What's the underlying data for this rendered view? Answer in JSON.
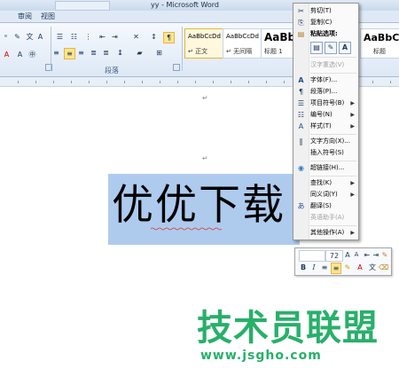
{
  "window": {
    "title": "yy - Microsoft Word"
  },
  "tabs": [
    "审阅",
    "视图"
  ],
  "ribbon": {
    "paragraph_group_label": "段落",
    "styles": [
      {
        "sample": "AaBbCcDd",
        "name": "↵ 正文",
        "selected": true
      },
      {
        "sample": "AaBbCcDd",
        "name": "↵ 无间隔",
        "selected": false
      },
      {
        "sample": "AaBb",
        "name": "标题 1",
        "selected": false
      }
    ],
    "style_right_sample": "AaBbC",
    "style_right_name": "标题"
  },
  "document": {
    "selected_text": "优优下载",
    "para_mark": "↵"
  },
  "context_menu": {
    "items": [
      {
        "label": "剪切(T)",
        "icon": "scissors-icon",
        "glyph": "✂",
        "enabled": true
      },
      {
        "label": "复制(C)",
        "icon": "copy-icon",
        "glyph": "⎘",
        "enabled": true
      },
      {
        "label": "粘贴选项:",
        "icon": "paste-icon",
        "glyph": "📋",
        "enabled": true,
        "header": true
      },
      {
        "label": "汉字重选(V)",
        "icon": "",
        "glyph": "",
        "enabled": false
      },
      {
        "label": "字体(F)...",
        "icon": "font-icon",
        "glyph": "A",
        "enabled": true
      },
      {
        "label": "段落(P)...",
        "icon": "paragraph-icon",
        "glyph": "¶",
        "enabled": true
      },
      {
        "label": "项目符号(B)",
        "icon": "bullets-icon",
        "glyph": "☰",
        "enabled": true,
        "submenu": true
      },
      {
        "label": "编号(N)",
        "icon": "numbering-icon",
        "glyph": "☷",
        "enabled": true,
        "submenu": true
      },
      {
        "label": "样式(T)",
        "icon": "styles-icon",
        "glyph": "A",
        "enabled": true,
        "submenu": true
      },
      {
        "label": "文字方向(X)...",
        "icon": "text-direction-icon",
        "glyph": "‖",
        "enabled": true
      },
      {
        "label": "插入符号(S)",
        "icon": "",
        "glyph": "",
        "enabled": true
      },
      {
        "label": "超链接(H)...",
        "icon": "hyperlink-icon",
        "glyph": "🌐",
        "enabled": true
      },
      {
        "label": "查找(K)",
        "icon": "",
        "glyph": "",
        "enabled": true,
        "submenu": true
      },
      {
        "label": "同义词(Y)",
        "icon": "",
        "glyph": "",
        "enabled": true,
        "submenu": true
      },
      {
        "label": "翻译(S)",
        "icon": "translate-icon",
        "glyph": "あ",
        "enabled": true
      },
      {
        "label": "英语助手(A)",
        "icon": "",
        "glyph": "",
        "enabled": false
      },
      {
        "label": "其他操作(A)",
        "icon": "",
        "glyph": "",
        "enabled": true,
        "submenu": true
      }
    ],
    "paste_options": [
      "keep-format-icon",
      "merge-format-icon",
      "text-only-icon"
    ]
  },
  "mini_toolbar": {
    "font_size": "72",
    "bold": "B",
    "italic": "I"
  },
  "watermark": {
    "line1": "技术员联盟",
    "line2": "www.jsgho.com"
  },
  "colors": {
    "selection": "#aecbee",
    "watermark": "#28b06a",
    "highlight_style": "#e7b43a"
  }
}
